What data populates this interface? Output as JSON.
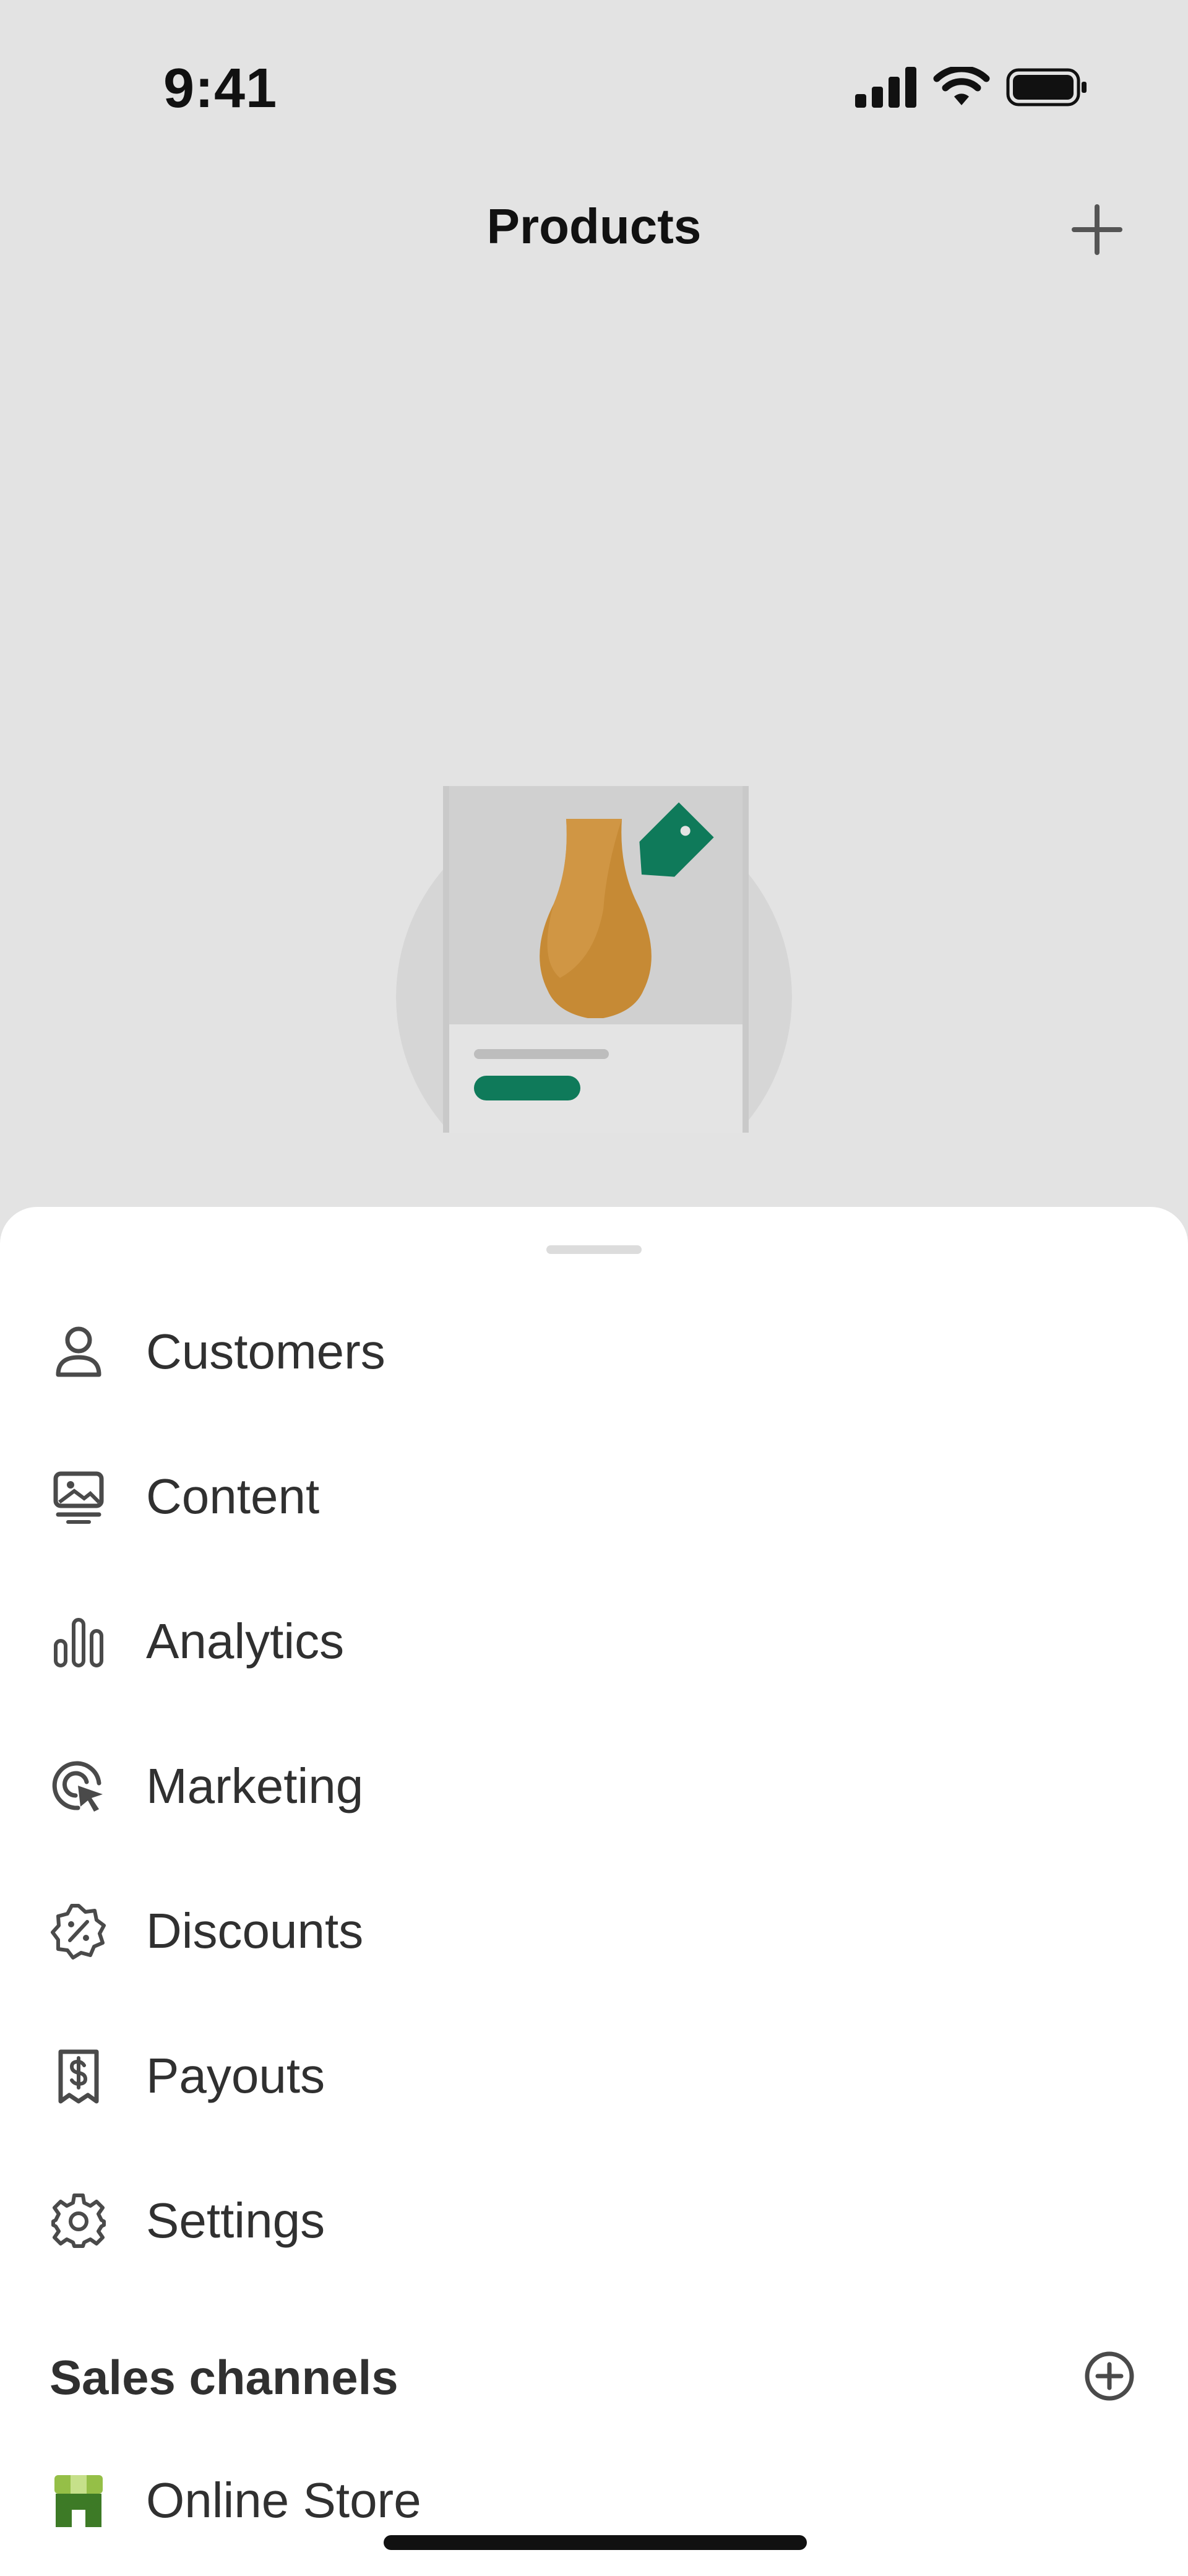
{
  "status_bar": {
    "time": "9:41",
    "icons": [
      "signal-icon",
      "wifi-icon",
      "battery-icon"
    ]
  },
  "nav": {
    "title": "Products",
    "add_icon": "plus-icon"
  },
  "empty_state": {
    "illustration": "product-vase-price-tag-illustration"
  },
  "menu": {
    "items": [
      {
        "label": "Customers",
        "icon": "person-icon"
      },
      {
        "label": "Content",
        "icon": "image-icon"
      },
      {
        "label": "Analytics",
        "icon": "bar-chart-icon"
      },
      {
        "label": "Marketing",
        "icon": "target-cursor-icon"
      },
      {
        "label": "Discounts",
        "icon": "discount-badge-icon"
      },
      {
        "label": "Payouts",
        "icon": "receipt-dollar-icon"
      },
      {
        "label": "Settings",
        "icon": "gear-icon"
      }
    ],
    "sales_channels": {
      "title": "Sales channels",
      "add_icon": "circle-plus-icon",
      "items": [
        {
          "label": "Online Store",
          "icon": "storefront-icon"
        }
      ]
    }
  },
  "colors": {
    "accent_green": "#0f7a5a",
    "vase": "#c68a35",
    "background": "#e3e3e3",
    "sheet": "#ffffff"
  }
}
